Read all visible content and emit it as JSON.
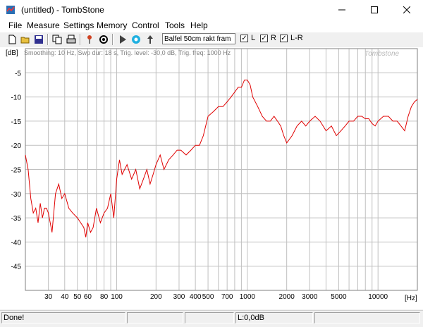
{
  "window": {
    "title": "(untitled) - TombStone"
  },
  "menu": [
    "File",
    "Measure",
    "Settings",
    "Memory",
    "Control",
    "Tools",
    "Help"
  ],
  "toolbar": {
    "memo_value": "Balfel 50cm rakt fram",
    "checks": [
      {
        "label": "L",
        "checked": true
      },
      {
        "label": "R",
        "checked": true
      },
      {
        "label": "L-R",
        "checked": true
      }
    ]
  },
  "plot": {
    "info": "Smoothing: 10 Hz, Swp dur: 18 s, Trig. level: -30,0 dB, Trig. freq: 1000 Hz",
    "watermark": "Tombstone"
  },
  "status": {
    "left": "Done!",
    "mid1": "",
    "mid2": "",
    "level": "L:0,0dB",
    "right": ""
  },
  "colors": {
    "trace": "#e00000",
    "grid": "#c0c0c0"
  },
  "chart_data": {
    "type": "line",
    "xlabel": "[Hz]",
    "ylabel": "[dB]",
    "xscale": "log",
    "xlim": [
      20,
      20000
    ],
    "ylim": [
      -50,
      0
    ],
    "xticks": [
      30,
      40,
      50,
      60,
      80,
      100,
      200,
      300,
      400,
      500,
      700,
      1000,
      2000,
      3000,
      5000,
      10000
    ],
    "xtick_labels": [
      "30",
      "40",
      "50",
      "60",
      "80",
      "100",
      "200",
      "300",
      "400",
      "500",
      "700",
      "1000",
      "2000",
      "3000",
      "5000",
      "10000"
    ],
    "yticks": [
      -5,
      -10,
      -15,
      -20,
      -25,
      -30,
      -35,
      -40,
      -45
    ],
    "ytick_labels": [
      "-5",
      "-10",
      "-15",
      "-20",
      "-25",
      "-30",
      "-35",
      "-40",
      "-45"
    ],
    "grid": true,
    "series": [
      {
        "x": [
          20,
          21,
          22,
          23,
          24,
          25,
          26,
          27,
          28,
          29,
          30,
          32,
          34,
          36,
          38,
          40,
          43,
          46,
          50,
          53,
          56,
          58,
          60,
          63,
          66,
          70,
          75,
          80,
          85,
          90,
          95,
          100,
          105,
          110,
          120,
          130,
          140,
          150,
          160,
          170,
          180,
          190,
          200,
          215,
          230,
          250,
          270,
          290,
          310,
          340,
          370,
          400,
          430,
          460,
          500,
          550,
          600,
          650,
          700,
          750,
          800,
          850,
          900,
          950,
          1000,
          1050,
          1100,
          1200,
          1300,
          1400,
          1500,
          1600,
          1700,
          1800,
          1900,
          2000,
          2200,
          2400,
          2600,
          2800,
          3000,
          3300,
          3600,
          4000,
          4400,
          4800,
          5200,
          5600,
          6000,
          6500,
          7000,
          7500,
          8000,
          8500,
          9000,
          9500,
          10000,
          11000,
          12000,
          13000,
          14000,
          15000,
          16000,
          17000,
          18000,
          19000,
          20000
        ],
        "y": [
          -22,
          -25,
          -31,
          -34,
          -33,
          -36,
          -32,
          -35,
          -33,
          -33,
          -34,
          -38,
          -30,
          -28,
          -31,
          -30,
          -33,
          -34,
          -35,
          -36,
          -37,
          -39,
          -36,
          -38,
          -37,
          -33,
          -36,
          -34,
          -33,
          -30,
          -35,
          -27,
          -23,
          -26,
          -24,
          -27,
          -25,
          -29,
          -27,
          -25,
          -28,
          -26,
          -24,
          -22,
          -25,
          -23,
          -22,
          -21,
          -21,
          -22,
          -21,
          -20,
          -20,
          -18,
          -14,
          -13,
          -12,
          -12,
          -11,
          -10,
          -9,
          -8,
          -8,
          -6.5,
          -6.5,
          -7.5,
          -10,
          -12,
          -14,
          -15,
          -15,
          -14,
          -15,
          -16,
          -18,
          -19.5,
          -18,
          -16,
          -15,
          -16,
          -15,
          -14,
          -15,
          -17,
          -16,
          -18,
          -17,
          -16,
          -15,
          -15,
          -14,
          -14,
          -14.5,
          -14.5,
          -15.5,
          -16,
          -15,
          -14,
          -14,
          -15,
          -15,
          -16,
          -17,
          -14,
          -12,
          -11,
          -10.5
        ]
      }
    ]
  }
}
